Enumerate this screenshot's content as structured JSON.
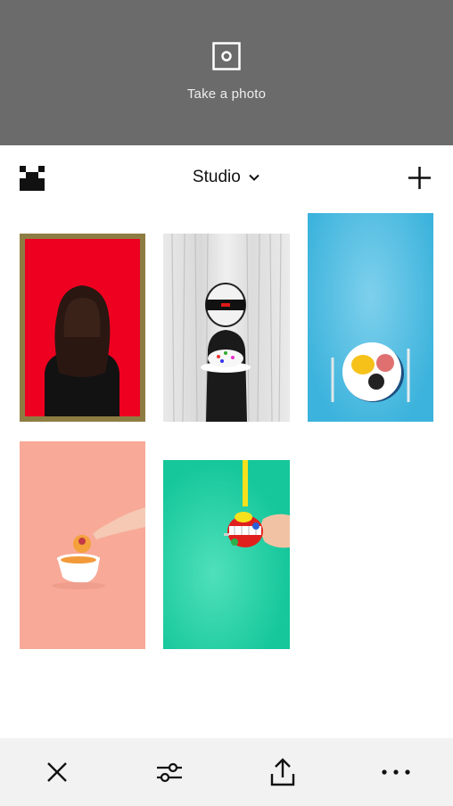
{
  "camera": {
    "label": "Take a photo",
    "icon": "camera-shutter-icon"
  },
  "header": {
    "logo_icon": "vsco-logo-icon",
    "title": "Studio",
    "dropdown_icon": "chevron-down-icon",
    "add_icon": "plus-icon"
  },
  "grid": {
    "photos": [
      {
        "subject": "person-hair-red-background",
        "border_color": "#8e7d43"
      },
      {
        "subject": "astronaut-helmet-cake"
      },
      {
        "subject": "breakfast-plate-blue-background"
      },
      {
        "subject": "donut-teacup-peach-background"
      },
      {
        "subject": "wind-up-teeth-green-background"
      }
    ]
  },
  "toolbar": {
    "items": [
      "close-icon",
      "adjust-sliders-icon",
      "share-upload-icon",
      "more-dots-icon"
    ]
  },
  "colors": {
    "camera_bg": "#6b6b6b",
    "toolbar_bg": "#f2f2f2",
    "text": "#111111"
  }
}
